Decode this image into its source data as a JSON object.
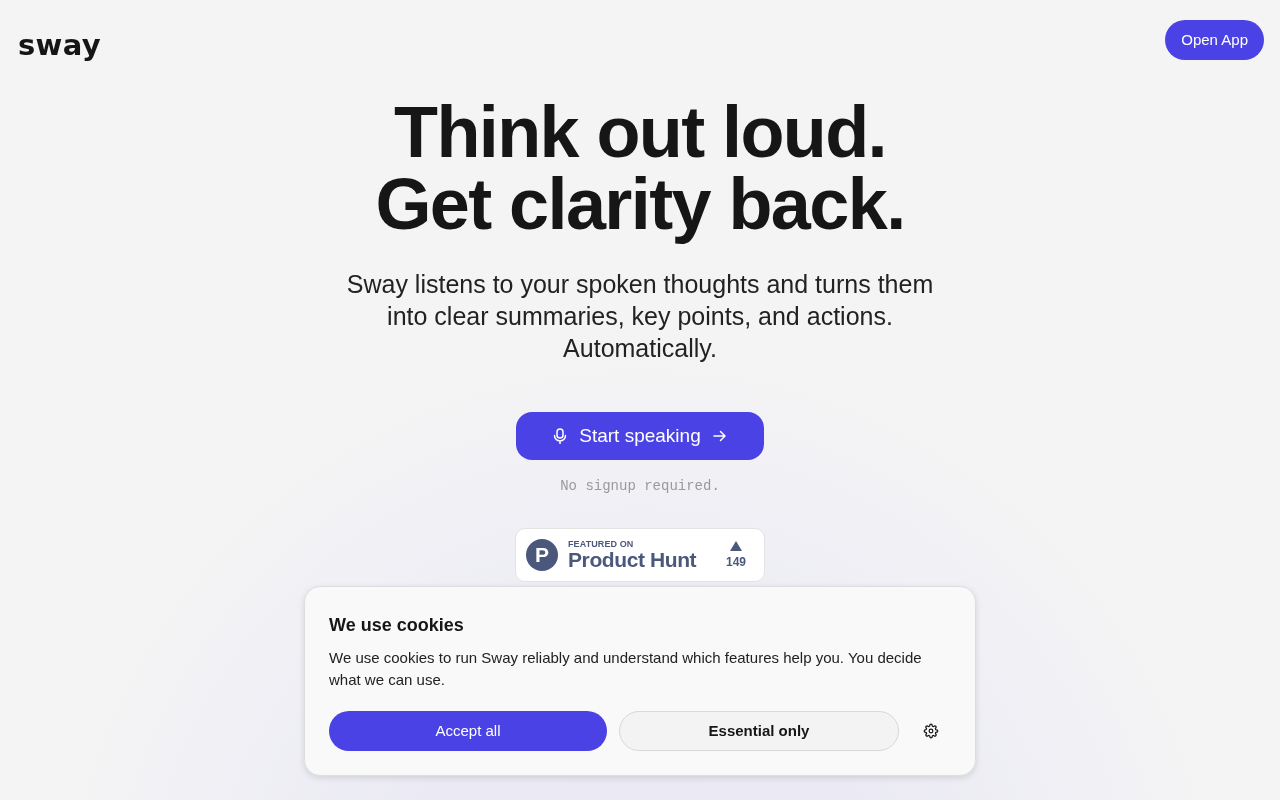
{
  "header": {
    "logo": "sway",
    "open_app_button": "Open App"
  },
  "hero": {
    "headline_lines": [
      "Think out loud.",
      "Get clarity back."
    ],
    "subtitle": "Sway listens to your spoken thoughts and turns them into clear summaries, key points, and actions. Automatically.",
    "cta_button": "Start speaking",
    "note": "No signup required."
  },
  "product_hunt_badge": {
    "logo_letter": "P",
    "eyebrow": "FEATURED ON",
    "name": "Product Hunt",
    "votes": "149"
  },
  "cookie_banner": {
    "title": "We use cookies",
    "text": "We use cookies to run Sway reliably and understand which features help you. You decide what we can use.",
    "buttons": [
      {
        "label": "Accept all",
        "kind": "primary"
      },
      {
        "label": "Essential only",
        "kind": "secondary"
      }
    ]
  }
}
